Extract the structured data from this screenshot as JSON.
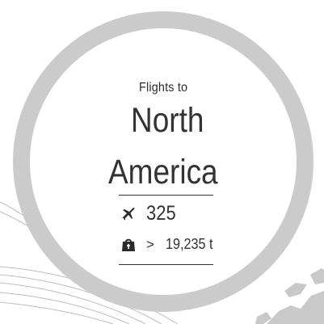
{
  "card": {
    "subtitle": "Flights to",
    "title_line1": "North",
    "title_line2": "America"
  },
  "stats": {
    "flights": {
      "icon": "airplane-icon",
      "value": "325"
    },
    "cargo": {
      "icon": "cargo-bag-icon",
      "operator": ">",
      "value": "19,235 t"
    }
  },
  "colors": {
    "ring": "#cbcbcb",
    "text": "#333333",
    "background": "#ffffff",
    "map_land": "#c9c9c9",
    "route_lines": "#bdbdbd"
  }
}
